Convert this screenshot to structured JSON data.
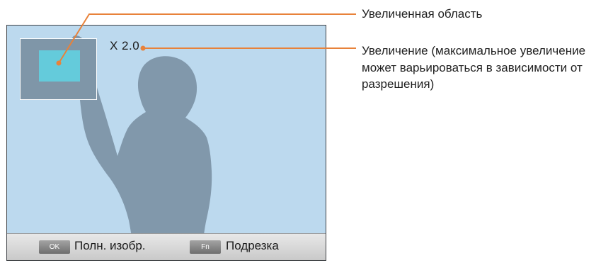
{
  "screen": {
    "zoom_level": "X 2.0",
    "colors": {
      "sky": "#bcd9ee",
      "silhouette": "#8198ab",
      "zoom_area": "#64cbdb",
      "callout": "#e8823a"
    }
  },
  "bottom_bar": {
    "ok_key": "OK",
    "ok_action": "Полн. изобр.",
    "fn_key": "Fn",
    "fn_action": "Подрезка"
  },
  "callouts": {
    "zoom_area_label": "Увеличенная область",
    "zoom_level_label": "Увеличение (максимальное увеличение может варьироваться в зависимости от разрешения)"
  }
}
